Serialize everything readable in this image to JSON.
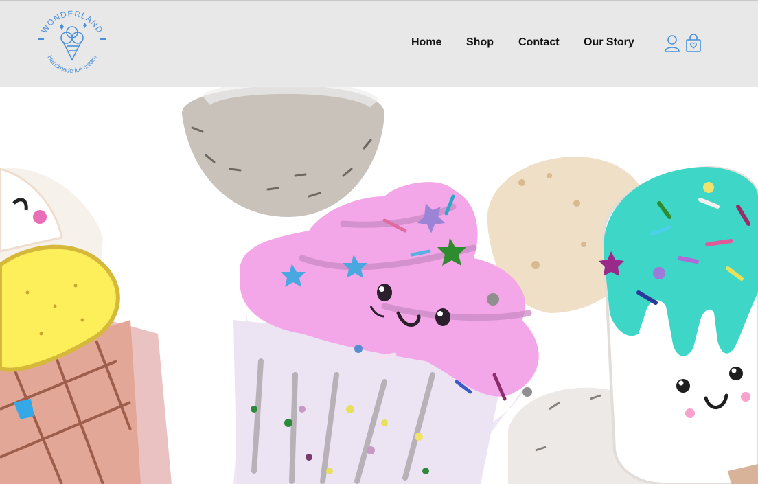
{
  "brand": {
    "name": "WONDERLAND",
    "tagline": "Handmade ice cream",
    "logo_icon": "ice-cream-cone-icon",
    "accent_color": "#4a90d9"
  },
  "nav": {
    "items": [
      {
        "label": "Home"
      },
      {
        "label": "Shop"
      },
      {
        "label": "Contact"
      },
      {
        "label": "Our Story"
      }
    ]
  },
  "actions": {
    "account_icon": "user-icon",
    "cart_icon": "shopping-bag-icon"
  },
  "hero": {
    "illustration": "ice-cream-illustration",
    "colors": {
      "cupcake_frosting": "#f3a6e8",
      "popsicle_glaze": "#3ed6c6",
      "cone_ice_cream": "#fcef5a",
      "waffle_cone": "#e3a797"
    }
  }
}
